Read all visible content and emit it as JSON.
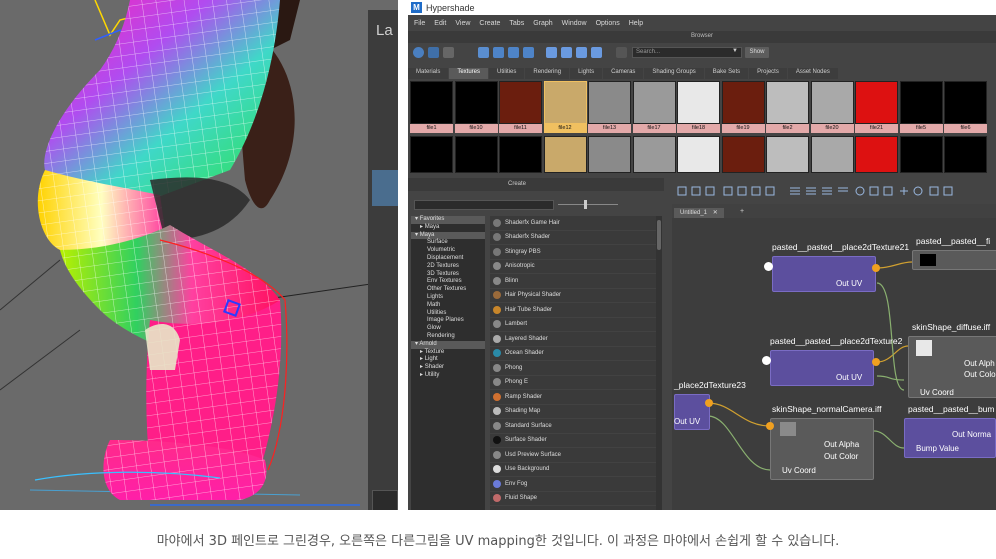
{
  "viewport": {
    "side_panel_label": "La"
  },
  "window": {
    "title": "Hypershade",
    "app_icon": "M",
    "menu": [
      "File",
      "Edit",
      "View",
      "Create",
      "Tabs",
      "Graph",
      "Window",
      "Options",
      "Help"
    ]
  },
  "browser": {
    "section_title": "Browser",
    "search_placeholder": "Search...",
    "show_label": "Show",
    "tabs": [
      "Materials",
      "Textures",
      "Utilities",
      "Rendering",
      "Lights",
      "Cameras",
      "Shading Groups",
      "Bake Sets",
      "Projects",
      "Asset Nodes"
    ],
    "active_tab": "Textures",
    "swatches_row1": [
      {
        "name": "file1",
        "color": "#000000"
      },
      {
        "name": "file10",
        "color": "#000000"
      },
      {
        "name": "file11",
        "color": "#6b1e0e"
      },
      {
        "name": "file12",
        "color": "#c9a96a",
        "selected": true
      },
      {
        "name": "file13",
        "color": "#8a8a8a"
      },
      {
        "name": "file17",
        "color": "#9a9a9a"
      },
      {
        "name": "file18",
        "color": "#e8e8e8"
      },
      {
        "name": "file19",
        "color": "#6b1e0e"
      },
      {
        "name": "file2",
        "color": "#bdbdbd"
      },
      {
        "name": "file20",
        "color": "#a9a9a9"
      },
      {
        "name": "file21",
        "color": "#dd1111"
      },
      {
        "name": "file5",
        "color": "#000000"
      },
      {
        "name": "file6",
        "color": "#000000"
      }
    ],
    "swatches_row2": [
      "#000000",
      "#000000",
      "#000000",
      "#c9a96a",
      "#8a8a8a",
      "#9a9a9a",
      "#e8e8e8",
      "#6b1e0e",
      "#bdbdbd",
      "#a9a9a9",
      "#dd1111",
      "#000000",
      "#000000"
    ]
  },
  "create": {
    "title": "Create",
    "categories": [
      {
        "label": "Favorites",
        "type": "hdr"
      },
      {
        "label": "Maya",
        "type": "sub"
      },
      {
        "label": "Maya",
        "type": "hdr"
      },
      {
        "label": "Surface",
        "type": "item"
      },
      {
        "label": "Volumetric",
        "type": "item"
      },
      {
        "label": "Displacement",
        "type": "item"
      },
      {
        "label": "2D Textures",
        "type": "item"
      },
      {
        "label": "3D Textures",
        "type": "item"
      },
      {
        "label": "Env Textures",
        "type": "item"
      },
      {
        "label": "Other Textures",
        "type": "item"
      },
      {
        "label": "Lights",
        "type": "item"
      },
      {
        "label": "Math",
        "type": "item"
      },
      {
        "label": "Utilities",
        "type": "item"
      },
      {
        "label": "Image Planes",
        "type": "item"
      },
      {
        "label": "Glow",
        "type": "item"
      },
      {
        "label": "Rendering",
        "type": "item"
      },
      {
        "label": "Arnold",
        "type": "hdr"
      },
      {
        "label": "Texture",
        "type": "sub"
      },
      {
        "label": "Light",
        "type": "sub"
      },
      {
        "label": "Shader",
        "type": "sub"
      },
      {
        "label": "Utility",
        "type": "sub"
      }
    ],
    "nodes": [
      {
        "label": "Shaderfx Game Hair",
        "icon": "#777777"
      },
      {
        "label": "Shaderfx Shader",
        "icon": "#777777"
      },
      {
        "label": "Stingray PBS",
        "icon": "#777777"
      },
      {
        "label": "Anisotropic",
        "icon": "#888888"
      },
      {
        "label": "Blinn",
        "icon": "#888888"
      },
      {
        "label": "Hair Physical Shader",
        "icon": "#9a6a3a"
      },
      {
        "label": "Hair Tube Shader",
        "icon": "#c8862a"
      },
      {
        "label": "Lambert",
        "icon": "#888888"
      },
      {
        "label": "Layered Shader",
        "icon": "#aaaaaa"
      },
      {
        "label": "Ocean Shader",
        "icon": "#2a8aa8"
      },
      {
        "label": "Phong",
        "icon": "#888888"
      },
      {
        "label": "Phong E",
        "icon": "#888888"
      },
      {
        "label": "Ramp Shader",
        "icon": "#d07030"
      },
      {
        "label": "Shading Map",
        "icon": "#bbbbbb"
      },
      {
        "label": "Standard Surface",
        "icon": "#888888"
      },
      {
        "label": "Surface Shader",
        "icon": "#111111"
      },
      {
        "label": "Usd Preview Surface",
        "icon": "#888888"
      },
      {
        "label": "Use Background",
        "icon": "#dddddd"
      },
      {
        "label": "Env Fog",
        "icon": "#6a7ad8"
      },
      {
        "label": "Fluid Shape",
        "icon": "#c06a6a"
      }
    ]
  },
  "graph": {
    "tab_label": "Untitled_1",
    "tab_close": "✕",
    "tab_add": "+",
    "nodes": {
      "place_a": {
        "title": "pasted__pasted__place2dTexture21",
        "port": "Out UV"
      },
      "file_a": {
        "title": "pasted__pasted__fi"
      },
      "place_b": {
        "title": "pasted__pasted__place2dTexture2",
        "port": "Out UV"
      },
      "diffuse": {
        "title": "skinShape_diffuse.iff",
        "ports": [
          "Out Alph",
          "Out Colo",
          "Uv Coord"
        ]
      },
      "place_c": {
        "title": "_place2dTexture23",
        "port": "Out UV"
      },
      "normal": {
        "title": "skinShape_normalCamera.iff",
        "ports": [
          "Out Alpha",
          "Out Color",
          "Uv Coord"
        ]
      },
      "bump": {
        "title": "pasted__pasted__bum",
        "ports": [
          "Out Norma",
          "Bump Value"
        ]
      }
    }
  },
  "caption": "마야에서 3D 페인트로 그린경우, 오른쪽은 다른그림을 UV mapping한 것입니다. 이 과정은 마야에서 손쉽게 할 수 있습니다."
}
